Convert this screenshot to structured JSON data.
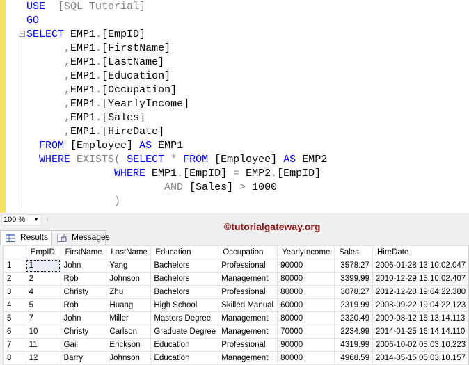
{
  "editor": {
    "lines": [
      [
        [
          "kw",
          "USE"
        ],
        [
          "",
          "  "
        ],
        [
          "op",
          "[SQL Tutorial]"
        ]
      ],
      [
        [
          "kw",
          "GO"
        ]
      ],
      [
        [
          "kw",
          "SELECT"
        ],
        [
          "",
          " EMP1"
        ],
        [
          "op",
          "."
        ],
        [
          "",
          "[EmpID]"
        ]
      ],
      [
        [
          "",
          "      "
        ],
        [
          "op",
          ","
        ],
        [
          "",
          "EMP1"
        ],
        [
          "op",
          "."
        ],
        [
          "",
          "[FirstName]"
        ]
      ],
      [
        [
          "",
          "      "
        ],
        [
          "op",
          ","
        ],
        [
          "",
          "EMP1"
        ],
        [
          "op",
          "."
        ],
        [
          "",
          "[LastName]"
        ]
      ],
      [
        [
          "",
          "      "
        ],
        [
          "op",
          ","
        ],
        [
          "",
          "EMP1"
        ],
        [
          "op",
          "."
        ],
        [
          "",
          "[Education]"
        ]
      ],
      [
        [
          "",
          "      "
        ],
        [
          "op",
          ","
        ],
        [
          "",
          "EMP1"
        ],
        [
          "op",
          "."
        ],
        [
          "",
          "[Occupation]"
        ]
      ],
      [
        [
          "",
          "      "
        ],
        [
          "op",
          ","
        ],
        [
          "",
          "EMP1"
        ],
        [
          "op",
          "."
        ],
        [
          "",
          "[YearlyIncome]"
        ]
      ],
      [
        [
          "",
          "      "
        ],
        [
          "op",
          ","
        ],
        [
          "",
          "EMP1"
        ],
        [
          "op",
          "."
        ],
        [
          "",
          "[Sales]"
        ]
      ],
      [
        [
          "",
          "      "
        ],
        [
          "op",
          ","
        ],
        [
          "",
          "EMP1"
        ],
        [
          "op",
          "."
        ],
        [
          "",
          "[HireDate]"
        ]
      ],
      [
        [
          "",
          "  "
        ],
        [
          "kw",
          "FROM"
        ],
        [
          "",
          " [Employee] "
        ],
        [
          "kw",
          "AS"
        ],
        [
          "",
          " EMP1"
        ]
      ],
      [
        [
          "",
          "  "
        ],
        [
          "kw",
          "WHERE"
        ],
        [
          "",
          " "
        ],
        [
          "op",
          "EXISTS("
        ],
        [
          "",
          " "
        ],
        [
          "kw",
          "SELECT"
        ],
        [
          "",
          " "
        ],
        [
          "op",
          "*"
        ],
        [
          "",
          " "
        ],
        [
          "kw",
          "FROM"
        ],
        [
          "",
          " [Employee] "
        ],
        [
          "kw",
          "AS"
        ],
        [
          "",
          " EMP2"
        ]
      ],
      [
        [
          "",
          "              "
        ],
        [
          "kw",
          "WHERE"
        ],
        [
          "",
          " EMP1"
        ],
        [
          "op",
          "."
        ],
        [
          "",
          "[EmpID] "
        ],
        [
          "op",
          "="
        ],
        [
          "",
          " EMP2"
        ],
        [
          "op",
          "."
        ],
        [
          "",
          "[EmpID]"
        ]
      ],
      [
        [
          "",
          "                      "
        ],
        [
          "op",
          "AND"
        ],
        [
          "",
          " [Sales] "
        ],
        [
          "op",
          ">"
        ],
        [
          "",
          " 1000"
        ]
      ],
      [
        [
          "",
          "              "
        ],
        [
          "op",
          ")"
        ]
      ]
    ]
  },
  "status": {
    "zoom": "100 %",
    "watermark": "©tutorialgateway.org"
  },
  "tabs": {
    "results": "Results",
    "messages": "Messages"
  },
  "grid": {
    "columns": [
      "",
      "EmpID",
      "FirstName",
      "LastName",
      "Education",
      "Occupation",
      "YearlyIncome",
      "Sales",
      "HireDate"
    ],
    "rows": [
      [
        "1",
        "1",
        "John",
        "Yang",
        "Bachelors",
        "Professional",
        "90000",
        "3578.27",
        "2006-01-28 13:10:02.047"
      ],
      [
        "2",
        "2",
        "Rob",
        "Johnson",
        "Bachelors",
        "Management",
        "80000",
        "3399.99",
        "2010-12-29 15:10:02.407"
      ],
      [
        "3",
        "4",
        "Christy",
        "Zhu",
        "Bachelors",
        "Professional",
        "80000",
        "3078.27",
        "2012-12-28 19:04:22.380"
      ],
      [
        "4",
        "5",
        "Rob",
        "Huang",
        "High School",
        "Skilled Manual",
        "60000",
        "2319.99",
        "2008-09-22 19:04:22.123"
      ],
      [
        "5",
        "7",
        "John",
        "Miller",
        "Masters Degree",
        "Management",
        "80000",
        "2320.49",
        "2009-08-12 15:13:14.113"
      ],
      [
        "6",
        "10",
        "Christy",
        "Carlson",
        "Graduate Degree",
        "Management",
        "70000",
        "2234.99",
        "2014-01-25 16:14:14.110"
      ],
      [
        "7",
        "11",
        "Gail",
        "Erickson",
        "Education",
        "Professional",
        "90000",
        "4319.99",
        "2006-10-02 05:03:10.223"
      ],
      [
        "8",
        "12",
        "Barry",
        "Johnson",
        "Education",
        "Management",
        "80000",
        "4968.59",
        "2014-05-15 05:03:10.157"
      ]
    ]
  }
}
